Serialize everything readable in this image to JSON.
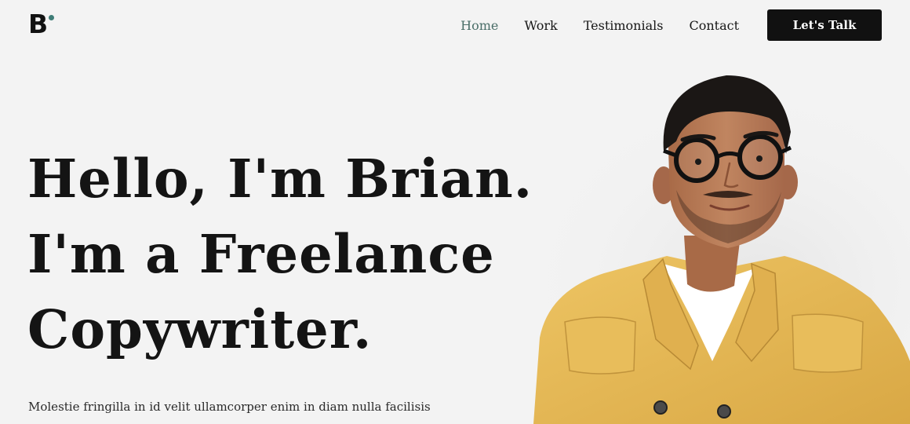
{
  "brand": {
    "logo_letter": "B",
    "accent_color": "#3f7d77"
  },
  "nav": {
    "items": [
      {
        "label": "Home",
        "active": true
      },
      {
        "label": "Work",
        "active": false
      },
      {
        "label": "Testimonials",
        "active": false
      },
      {
        "label": "Contact",
        "active": false
      }
    ],
    "cta_label": "Let's Talk"
  },
  "hero": {
    "headline_lines": [
      "Hello, I'm Brian.",
      "I'm a Freelance",
      "Copywriter."
    ],
    "subtext": "Molestie fringilla in id velit ullamcorper enim in diam nulla facilisis",
    "portrait": {
      "jacket_color": "#e5b84f",
      "shirt_color": "#ffffff",
      "skin_color": "#b47752",
      "hair_color": "#1b1715"
    }
  }
}
